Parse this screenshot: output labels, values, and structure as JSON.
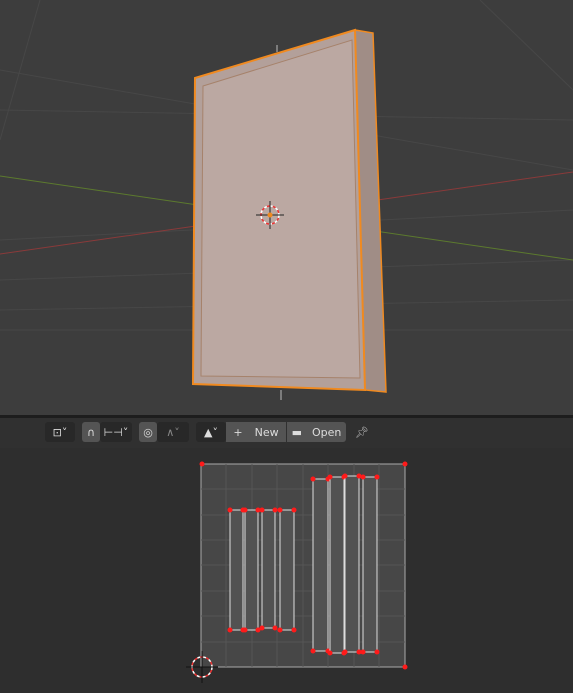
{
  "toolbar": {
    "pivot_icon": "pivot-point-icon",
    "snap_icon": "magnet-snap-icon",
    "snap_increment_icon": "snap-increment-icon",
    "proportional_icon": "proportional-edit-icon",
    "falloff_icon": "falloff-curve-icon",
    "image_browse_icon": "image-icon",
    "new_label": "New",
    "open_label": "Open",
    "pin_icon": "pin-icon"
  },
  "colors": {
    "selection": "#f08a20",
    "uv_vertex": "#ff1a1a",
    "face": "#b3a09a"
  }
}
